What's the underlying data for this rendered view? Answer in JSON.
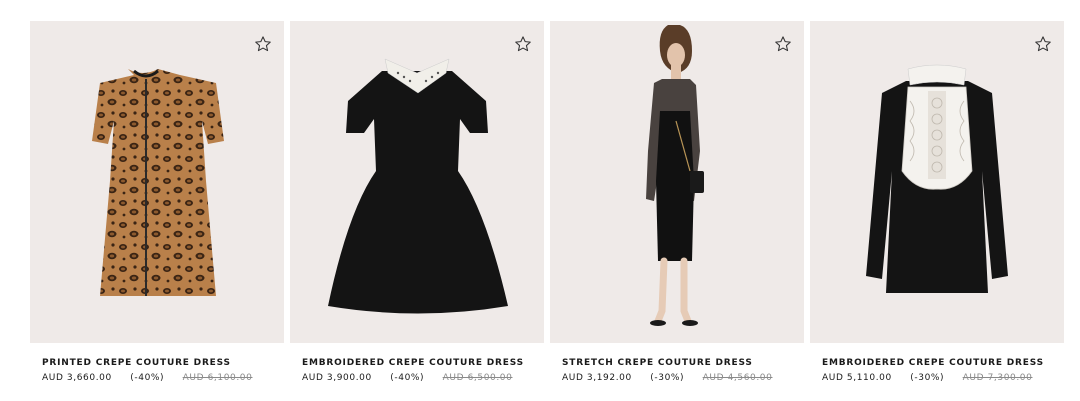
{
  "products": [
    {
      "name": "PRINTED CREPE COUTURE DRESS",
      "price": "AUD 3,660.00",
      "discount": "(-40%)",
      "original": "AUD 6,100.00"
    },
    {
      "name": "EMBROIDERED CREPE COUTURE DRESS",
      "price": "AUD 3,900.00",
      "discount": "(-40%)",
      "original": "AUD 6,500.00"
    },
    {
      "name": "STRETCH CREPE COUTURE DRESS",
      "price": "AUD 3,192.00",
      "discount": "(-30%)",
      "original": "AUD 4,560.00"
    },
    {
      "name": "EMBROIDERED CREPE COUTURE DRESS",
      "price": "AUD 5,110.00",
      "discount": "(-30%)",
      "original": "AUD 7,300.00"
    }
  ],
  "icons": {
    "wishlist": "star-outline-icon"
  },
  "colors": {
    "card_bg": "#efeae8",
    "text": "#1a1a1a",
    "strike": "#8a8a8a"
  }
}
